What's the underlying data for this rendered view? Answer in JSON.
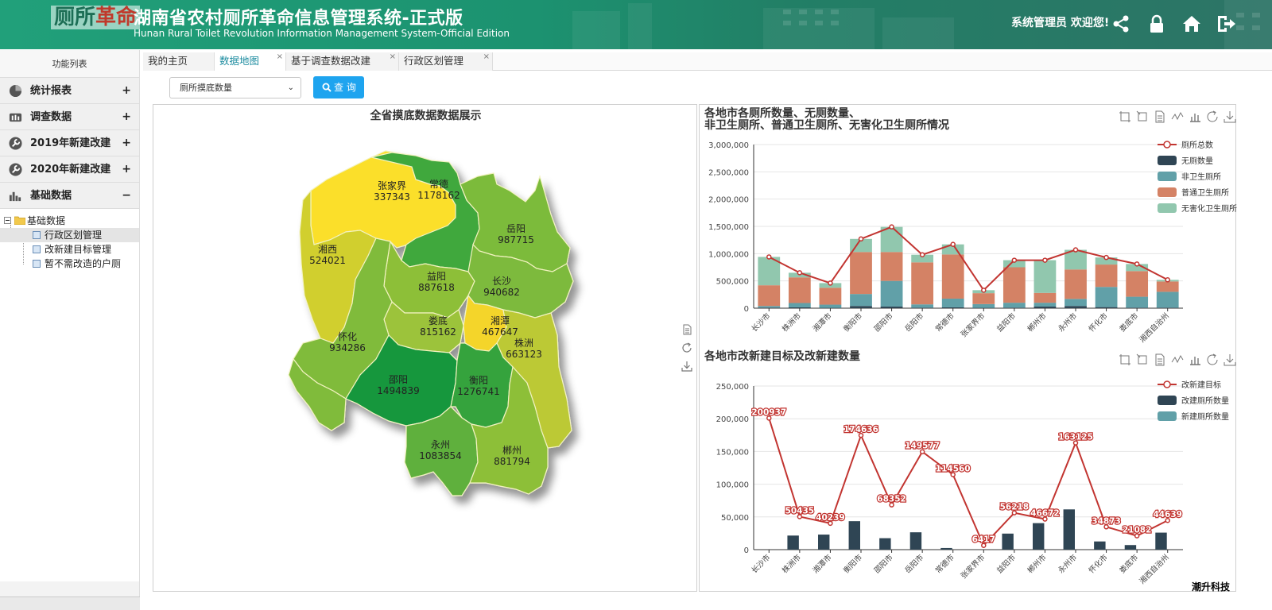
{
  "header": {
    "logo": {
      "part1": "厕所",
      "part2": "革命"
    },
    "title": "湖南省农村厕所革命信息管理系统-正式版",
    "subtitle": "Hunan Rural Toilet Revolution Information Management System-Official Edition",
    "welcome": "系统管理员 欢迎您!",
    "icons": [
      "share-icon",
      "lock-icon",
      "home-icon",
      "logout-icon"
    ]
  },
  "sidebar": {
    "title": "功能列表",
    "menu": [
      {
        "label": "统计报表",
        "icon": "pie-chart-icon",
        "sign": "+"
      },
      {
        "label": "调查数据",
        "icon": "bars-icon",
        "sign": "+"
      },
      {
        "label": "2019年新建改建",
        "icon": "wrench-icon",
        "sign": "+"
      },
      {
        "label": "2020年新建改建",
        "icon": "wrench-icon",
        "sign": "+"
      },
      {
        "label": "基础数据",
        "icon": "bar-chart-icon",
        "sign": "−"
      }
    ],
    "tree": {
      "root": "基础数据",
      "children": [
        "行政区划管理",
        "改新建目标管理",
        "暂不需改造的户厕"
      ]
    }
  },
  "tabs": [
    {
      "label": "我的主页"
    },
    {
      "label": "数据地图"
    },
    {
      "label": "基于调查数据改建"
    },
    {
      "label": "行政区划管理"
    }
  ],
  "toolbar": {
    "select_value": "厕所摸底数量",
    "query_label": "查 询"
  },
  "map": {
    "title": "全省摸底数据数据展示",
    "regions": [
      {
        "name": "张家界",
        "value": "337343",
        "color": "#fbdf2a"
      },
      {
        "name": "常德",
        "value": "1178162",
        "color": "#41a83c"
      },
      {
        "name": "岳阳",
        "value": "987715",
        "color": "#7cbb3b"
      },
      {
        "name": "湘西",
        "value": "524021",
        "color": "#d1cf2e"
      },
      {
        "name": "益阳",
        "value": "887618",
        "color": "#8dbf39"
      },
      {
        "name": "长沙",
        "value": "940682",
        "color": "#7dba3d"
      },
      {
        "name": "娄底",
        "value": "815162",
        "color": "#9cc33a"
      },
      {
        "name": "湘潭",
        "value": "467647",
        "color": "#f4d52a"
      },
      {
        "name": "怀化",
        "value": "934286",
        "color": "#80bb3b"
      },
      {
        "name": "株洲",
        "value": "663123",
        "color": "#bcc934"
      },
      {
        "name": "邵阳",
        "value": "1494839",
        "color": "#17973c"
      },
      {
        "name": "衡阳",
        "value": "1276741",
        "color": "#34a33d"
      },
      {
        "name": "永州",
        "value": "1083854",
        "color": "#5fb03c"
      },
      {
        "name": "郴州",
        "value": "881794",
        "color": "#8dbf39"
      }
    ]
  },
  "chart1_title_line1": "各地市各厕所数量、无厕数量、",
  "chart1_title_line2": "非卫生厕所、普通卫生厕所、无害化卫生厕所情况",
  "chart2_title": "各地市改新建目标及改新建数量",
  "colors": {
    "dark": "#2f4554",
    "teal": "#61a0a8",
    "orange": "#d48265",
    "mint": "#91c7ae",
    "red": "#c23531"
  },
  "chart_data": [
    {
      "type": "bar",
      "stacked": true,
      "title": "各地市各厕所数量、无厕数量、非卫生厕所、普通卫生厕所、无害化卫生厕所情况",
      "categories": [
        "长沙市",
        "株洲市",
        "湘潭市",
        "衡阳市",
        "邵阳市",
        "岳阳市",
        "常德市",
        "张家界市",
        "益阳市",
        "郴州市",
        "永州市",
        "怀化市",
        "娄底市",
        "湘西自治州"
      ],
      "yticks": [
        "0",
        "500,000",
        "1,000,000",
        "1,500,000",
        "2,000,000",
        "2,500,000",
        "3,000,000"
      ],
      "ylim": [
        0,
        3000000
      ],
      "legend_position": "top-right",
      "series": [
        {
          "name": "厕所总数",
          "kind": "line",
          "color": "#c23531",
          "values": [
            940000,
            650000,
            460000,
            1270000,
            1490000,
            980000,
            1170000,
            330000,
            880000,
            880000,
            1070000,
            930000,
            810000,
            520000
          ]
        },
        {
          "name": "无厕数量",
          "kind": "bar",
          "color": "#2f4554",
          "values": [
            10000,
            15000,
            5000,
            40000,
            30000,
            10000,
            15000,
            5000,
            10000,
            30000,
            40000,
            20000,
            10000,
            10000
          ]
        },
        {
          "name": "非卫生厕所",
          "kind": "bar",
          "color": "#61a0a8",
          "values": [
            30000,
            80000,
            60000,
            220000,
            470000,
            60000,
            160000,
            70000,
            90000,
            70000,
            130000,
            370000,
            200000,
            290000
          ]
        },
        {
          "name": "普通卫生厕所",
          "kind": "bar",
          "color": "#d48265",
          "values": [
            380000,
            470000,
            310000,
            770000,
            530000,
            770000,
            810000,
            200000,
            650000,
            180000,
            540000,
            410000,
            470000,
            190000
          ]
        },
        {
          "name": "无害化卫生厕所",
          "kind": "bar",
          "color": "#91c7ae",
          "values": [
            520000,
            85000,
            85000,
            240000,
            460000,
            140000,
            185000,
            55000,
            130000,
            600000,
            360000,
            130000,
            130000,
            30000
          ]
        }
      ]
    },
    {
      "type": "bar",
      "title": "各地市改新建目标及改新建数量",
      "categories": [
        "长沙市",
        "株洲市",
        "湘潭市",
        "衡阳市",
        "邵阳市",
        "岳阳市",
        "常德市",
        "张家界市",
        "益阳市",
        "郴州市",
        "永州市",
        "怀化市",
        "娄底市",
        "湘西自治州"
      ],
      "yticks": [
        "0",
        "50,000",
        "100,000",
        "150,000",
        "200,000",
        "250,000"
      ],
      "ylim": [
        0,
        250000
      ],
      "legend_position": "top-right",
      "series": [
        {
          "name": "改新建目标",
          "kind": "line",
          "color": "#c23531",
          "values": [
            200937,
            50435,
            40239,
            174636,
            68352,
            149577,
            114560,
            6417,
            56218,
            46672,
            163125,
            34873,
            21082,
            44639
          ],
          "labels": [
            "200937",
            "50435",
            "40239",
            "174636",
            "68352",
            "149577",
            "114560",
            "6417",
            "56218",
            "46672",
            "163125",
            "34873",
            "21082",
            "44639"
          ]
        },
        {
          "name": "改建厕所数量",
          "kind": "bar",
          "color": "#2f4554",
          "values": [
            0,
            21500,
            23000,
            43500,
            17500,
            26500,
            2500,
            0,
            24500,
            40500,
            61500,
            12500,
            7000,
            26000
          ]
        },
        {
          "name": "新建厕所数量",
          "kind": "bar",
          "color": "#61a0a8",
          "values": [
            0,
            0,
            0,
            0,
            0,
            0,
            0,
            0,
            0,
            0,
            0,
            0,
            0,
            0
          ]
        }
      ]
    }
  ],
  "watermark": "潮升科技"
}
